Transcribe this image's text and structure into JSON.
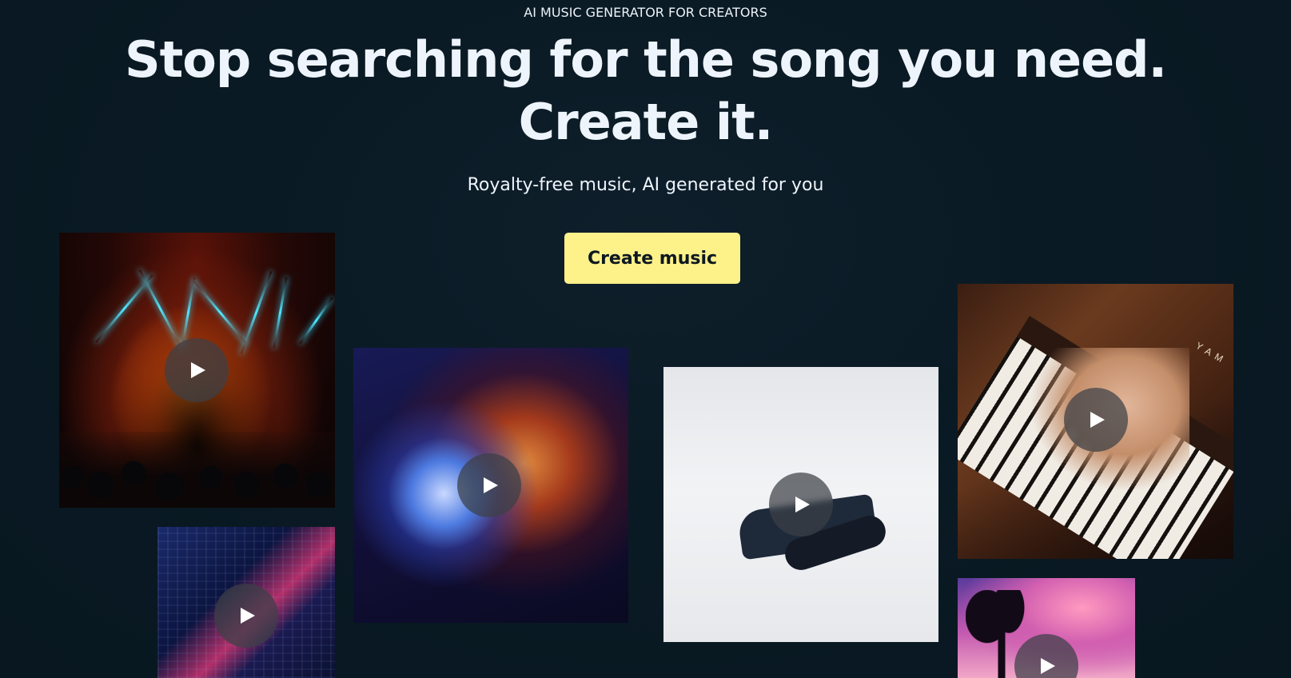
{
  "hero": {
    "eyebrow": "AI MUSIC GENERATOR FOR CREATORS",
    "headline_line1": "Stop searching for the song you need.",
    "headline_line2": "Create it.",
    "subheadline": "Royalty-free music, AI generated for you",
    "cta_label": "Create music"
  },
  "tiles": [
    {
      "name": "concert",
      "icon": "play-icon"
    },
    {
      "name": "city-night",
      "icon": "play-icon"
    },
    {
      "name": "disco-ball",
      "icon": "play-icon"
    },
    {
      "name": "dancer",
      "icon": "play-icon"
    },
    {
      "name": "piano",
      "icon": "play-icon",
      "brand_text": "YAM"
    },
    {
      "name": "palms",
      "icon": "play-icon"
    }
  ],
  "colors": {
    "background": "#0a1a24",
    "cta_background": "#fdf18a",
    "headline": "#eef4fb",
    "eyebrow_gradient_start": "#6fa9dc",
    "eyebrow_gradient_end": "#cfc49a"
  }
}
